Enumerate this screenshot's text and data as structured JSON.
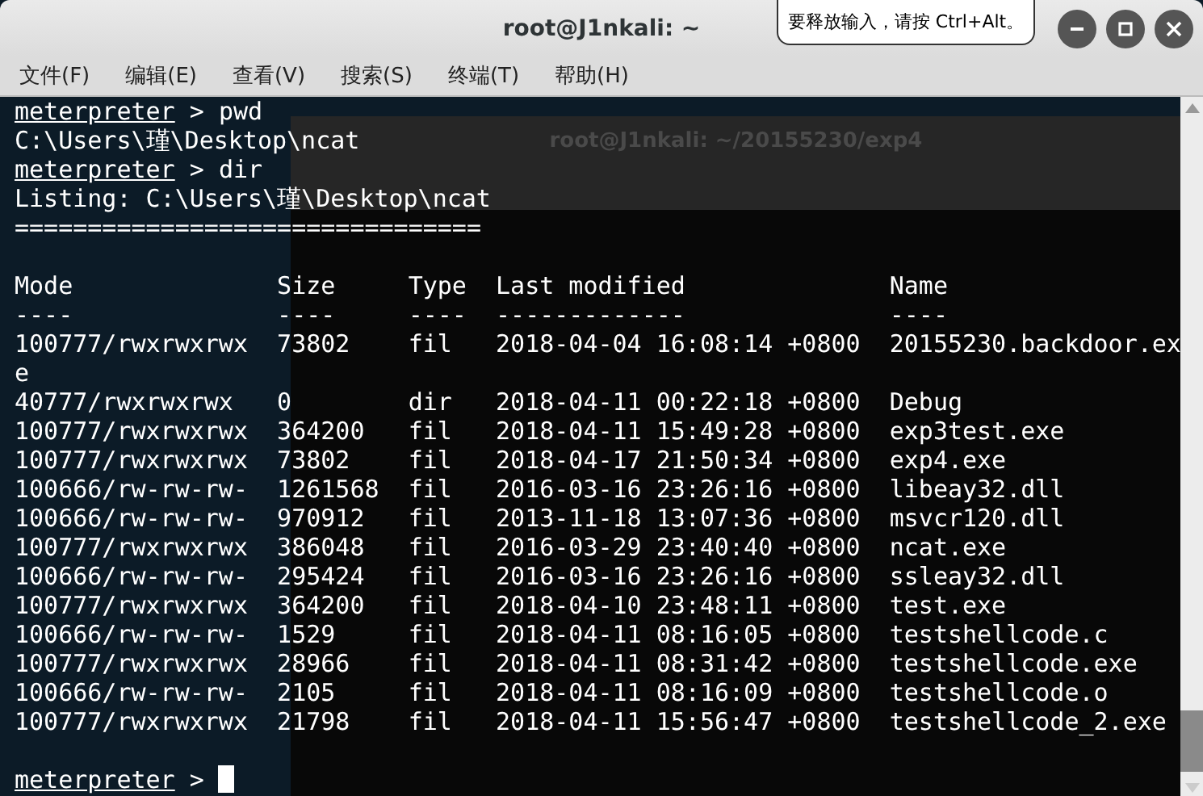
{
  "window": {
    "title": "root@J1nkali: ~"
  },
  "tooltip": "要释放输入，请按 Ctrl+Alt。",
  "menu": [
    "文件(F)",
    "编辑(E)",
    "查看(V)",
    "搜索(S)",
    "终端(T)",
    "帮助(H)"
  ],
  "background_window": {
    "title": "root@J1nkali: ~/20155230/exp4"
  },
  "lines": [
    {
      "kind": "prompt",
      "prompt": "meterpreter",
      "symbol": ">",
      "command": "pwd"
    },
    {
      "kind": "output",
      "text": "C:\\Users\\瑾\\Desktop\\ncat"
    },
    {
      "kind": "prompt",
      "prompt": "meterpreter",
      "symbol": ">",
      "command": "dir"
    },
    {
      "kind": "output",
      "text": "Listing: C:\\Users\\瑾\\Desktop\\ncat"
    },
    {
      "kind": "output",
      "text": "================================"
    },
    {
      "kind": "blank"
    },
    {
      "kind": "output",
      "text": "Mode              Size     Type  Last modified              Name"
    },
    {
      "kind": "output",
      "text": "----              ----     ----  -------------              ----"
    },
    {
      "kind": "output",
      "text": "100777/rwxrwxrwx  73802    fil   2018-04-04 16:08:14 +0800  20155230.backdoor.ex"
    },
    {
      "kind": "output",
      "text": "e"
    },
    {
      "kind": "output",
      "text": "40777/rwxrwxrwx   0        dir   2018-04-11 00:22:18 +0800  Debug"
    },
    {
      "kind": "output",
      "text": "100777/rwxrwxrwx  364200   fil   2018-04-11 15:49:28 +0800  exp3test.exe"
    },
    {
      "kind": "output",
      "text": "100777/rwxrwxrwx  73802    fil   2018-04-17 21:50:34 +0800  exp4.exe"
    },
    {
      "kind": "output",
      "text": "100666/rw-rw-rw-  1261568  fil   2016-03-16 23:26:16 +0800  libeay32.dll"
    },
    {
      "kind": "output",
      "text": "100666/rw-rw-rw-  970912   fil   2013-11-18 13:07:36 +0800  msvcr120.dll"
    },
    {
      "kind": "output",
      "text": "100777/rwxrwxrwx  386048   fil   2016-03-29 23:40:40 +0800  ncat.exe"
    },
    {
      "kind": "output",
      "text": "100666/rw-rw-rw-  295424   fil   2016-03-16 23:26:16 +0800  ssleay32.dll"
    },
    {
      "kind": "output",
      "text": "100777/rwxrwxrwx  364200   fil   2018-04-10 23:48:11 +0800  test.exe"
    },
    {
      "kind": "output",
      "text": "100666/rw-rw-rw-  1529     fil   2018-04-11 08:16:05 +0800  testshellcode.c"
    },
    {
      "kind": "output",
      "text": "100777/rwxrwxrwx  28966    fil   2018-04-11 08:31:42 +0800  testshellcode.exe"
    },
    {
      "kind": "output",
      "text": "100666/rw-rw-rw-  2105     fil   2018-04-11 08:16:09 +0800  testshellcode.o"
    },
    {
      "kind": "output",
      "text": "100777/rwxrwxrwx  21798    fil   2018-04-11 15:56:47 +0800  testshellcode_2.exe"
    },
    {
      "kind": "blank"
    },
    {
      "kind": "prompt",
      "prompt": "meterpreter",
      "symbol": ">",
      "cursor": true
    }
  ]
}
